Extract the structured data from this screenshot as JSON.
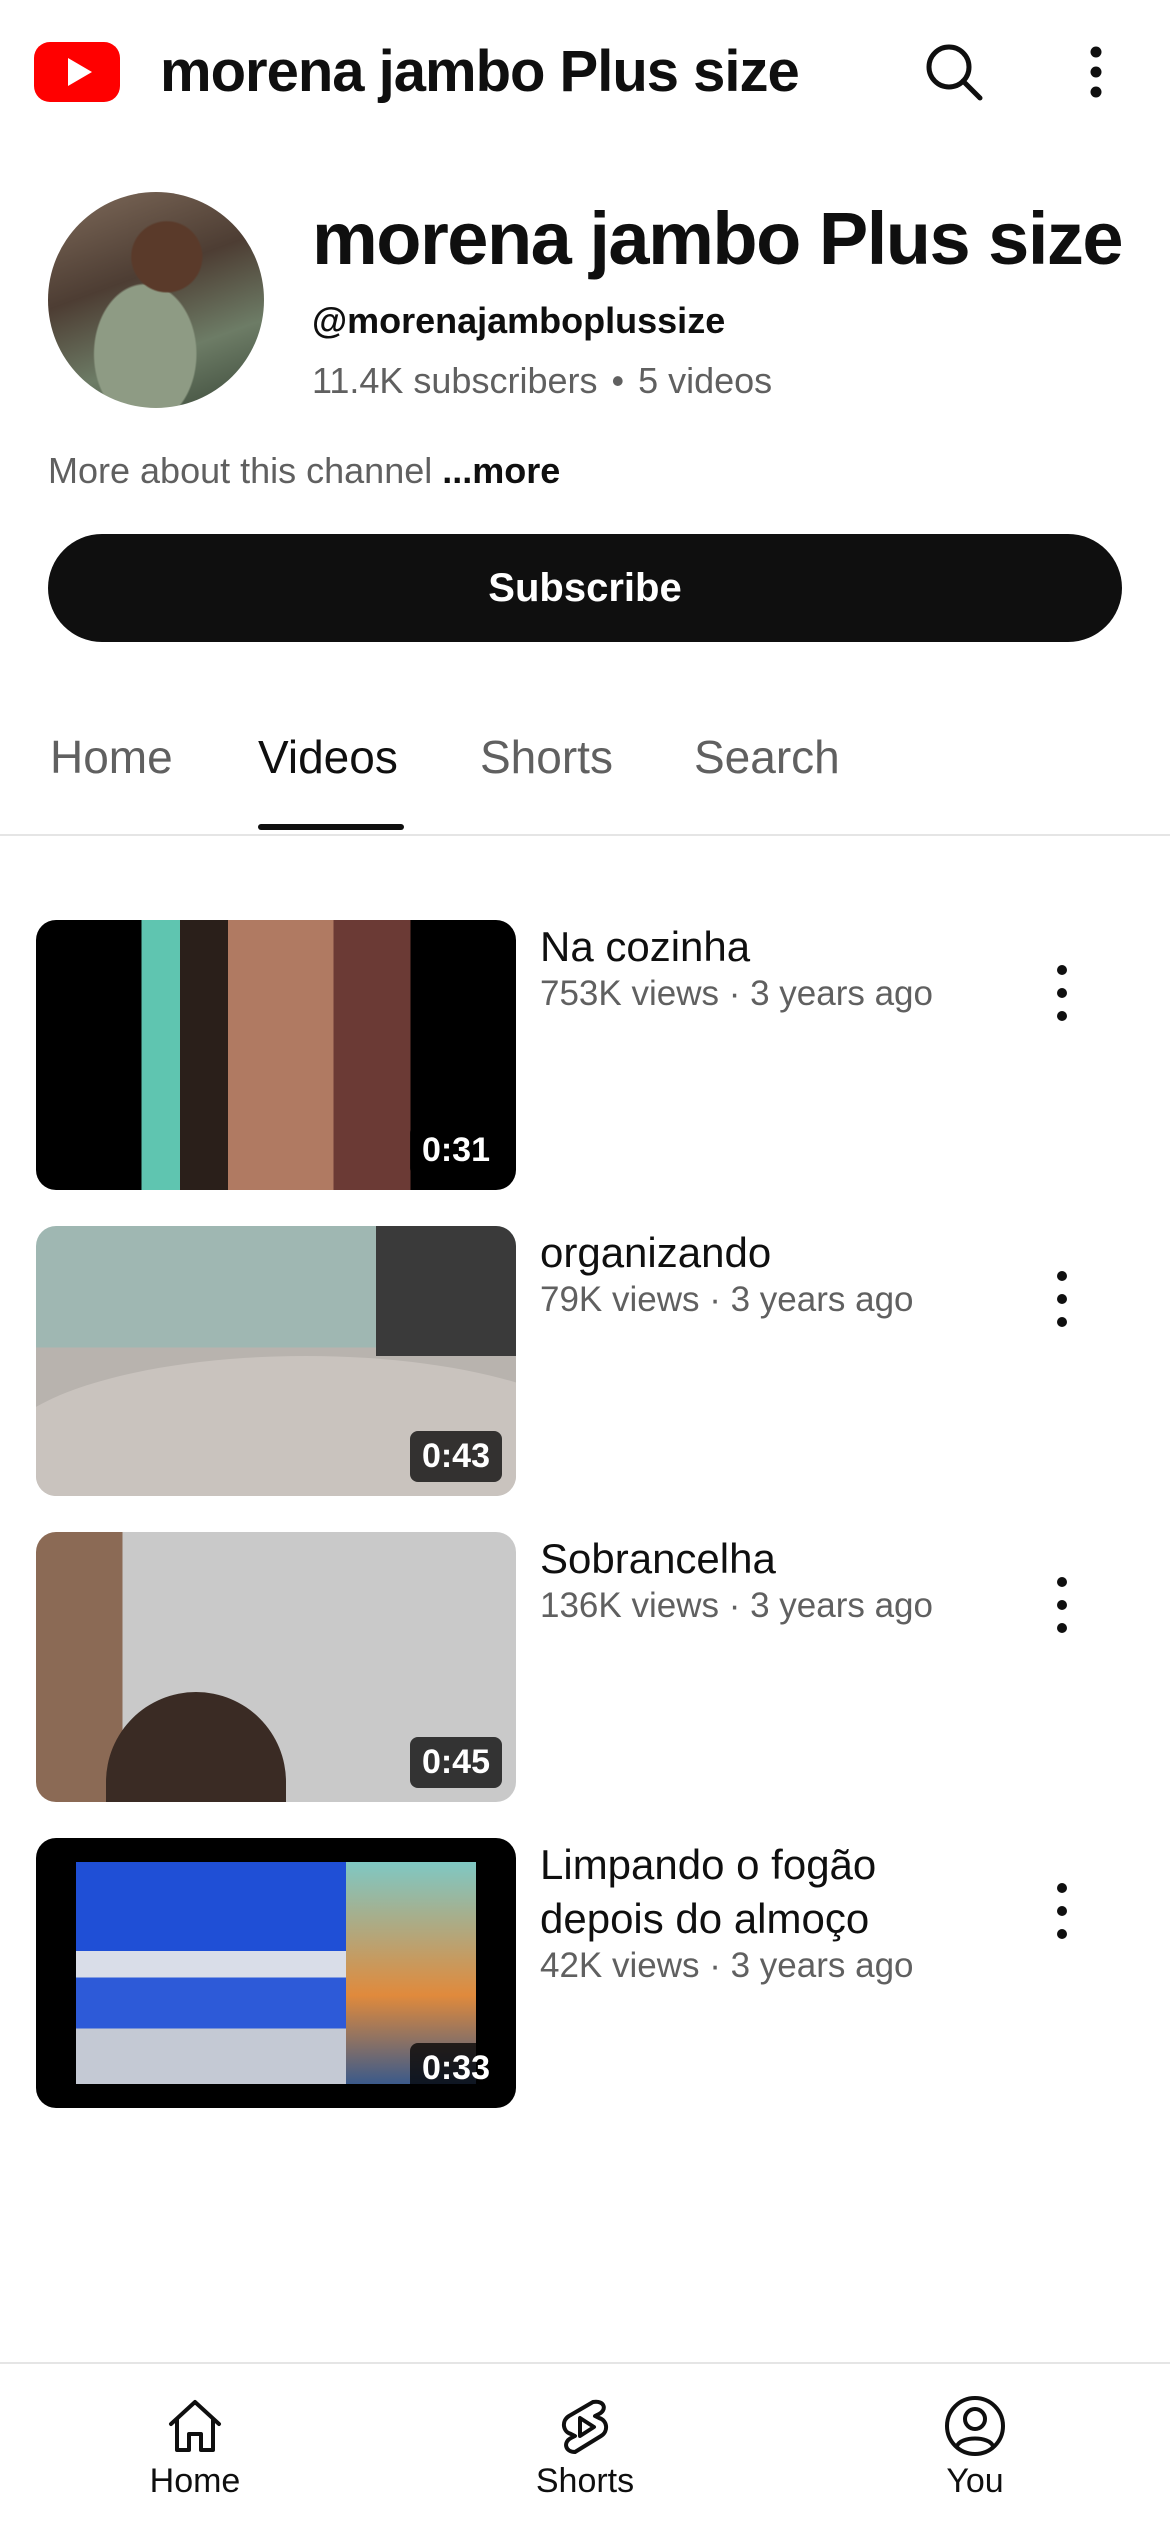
{
  "header": {
    "title": "morena jambo Plus size",
    "logo_icon": "youtube-logo-icon",
    "brand_color": "#ff0000"
  },
  "channel": {
    "name": "morena jambo Plus size",
    "handle": "@morenajamboplussize",
    "subscribers": "11.4K subscribers",
    "separator": "•",
    "video_count": "5 videos",
    "about_text": "More about this channel",
    "about_more": "...more",
    "subscribe_label": "Subscribe"
  },
  "tabs": [
    {
      "label": "Home",
      "active": false
    },
    {
      "label": "Videos",
      "active": true
    },
    {
      "label": "Shorts",
      "active": false
    },
    {
      "label": "Search",
      "active": false
    }
  ],
  "videos": [
    {
      "title": "Na cozinha",
      "meta": "753K views · 3 years ago",
      "duration": "0:31"
    },
    {
      "title": "organizando",
      "meta": "79K views · 3 years ago",
      "duration": "0:43"
    },
    {
      "title": "Sobrancelha",
      "meta": "136K views · 3 years ago",
      "duration": "0:45"
    },
    {
      "title": "Limpando o fogão depois do almoço",
      "meta": "42K views · 3 years ago",
      "duration": "0:33"
    }
  ],
  "bottom_nav": [
    {
      "label": "Home",
      "icon": "home-icon"
    },
    {
      "label": "Shorts",
      "icon": "shorts-icon"
    },
    {
      "label": "You",
      "icon": "account-icon"
    }
  ]
}
